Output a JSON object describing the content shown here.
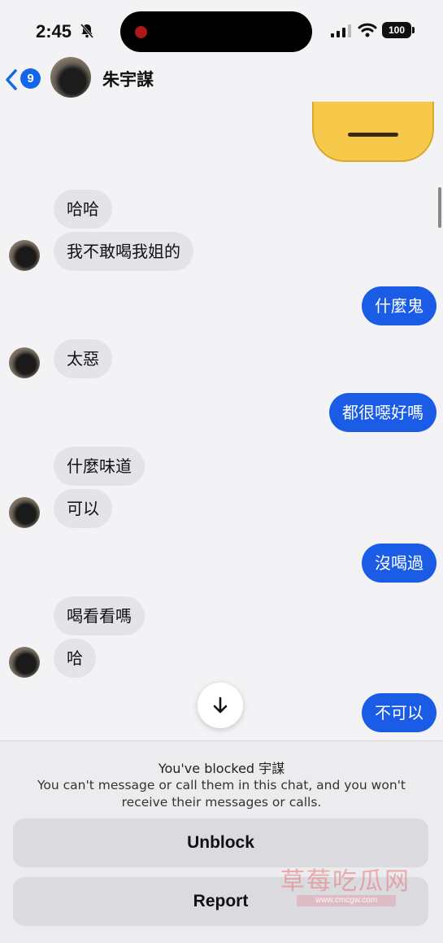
{
  "status": {
    "time": "2:45",
    "battery": "100"
  },
  "header": {
    "back_count": "9",
    "contact_name": "朱宇謀"
  },
  "messages": [
    {
      "dir": "in",
      "text": "哈哈"
    },
    {
      "dir": "in",
      "text": "我不敢喝我姐的"
    },
    {
      "dir": "out",
      "text": "什麼鬼"
    },
    {
      "dir": "in",
      "text": "太惡"
    },
    {
      "dir": "out",
      "text": "都很噁好嗎"
    },
    {
      "dir": "in",
      "text": "什麼味道"
    },
    {
      "dir": "in",
      "text": "可以"
    },
    {
      "dir": "out",
      "text": "沒喝過"
    },
    {
      "dir": "in",
      "text": "喝看看嗎"
    },
    {
      "dir": "in",
      "text": "哈"
    },
    {
      "dir": "out",
      "text": "不可以"
    }
  ],
  "blocked": {
    "title": "You've blocked 宇謀",
    "description": "You can't message or call them in this chat, and you won't receive their messages or calls.",
    "unblock_label": "Unblock",
    "report_label": "Report"
  },
  "watermark": {
    "text": "草莓吃瓜网",
    "url": "www.cmcgw.com"
  },
  "colors": {
    "outgoing_bubble": "#1a5ce6",
    "incoming_bubble": "#e4e4e8",
    "badge": "#1267e8"
  }
}
